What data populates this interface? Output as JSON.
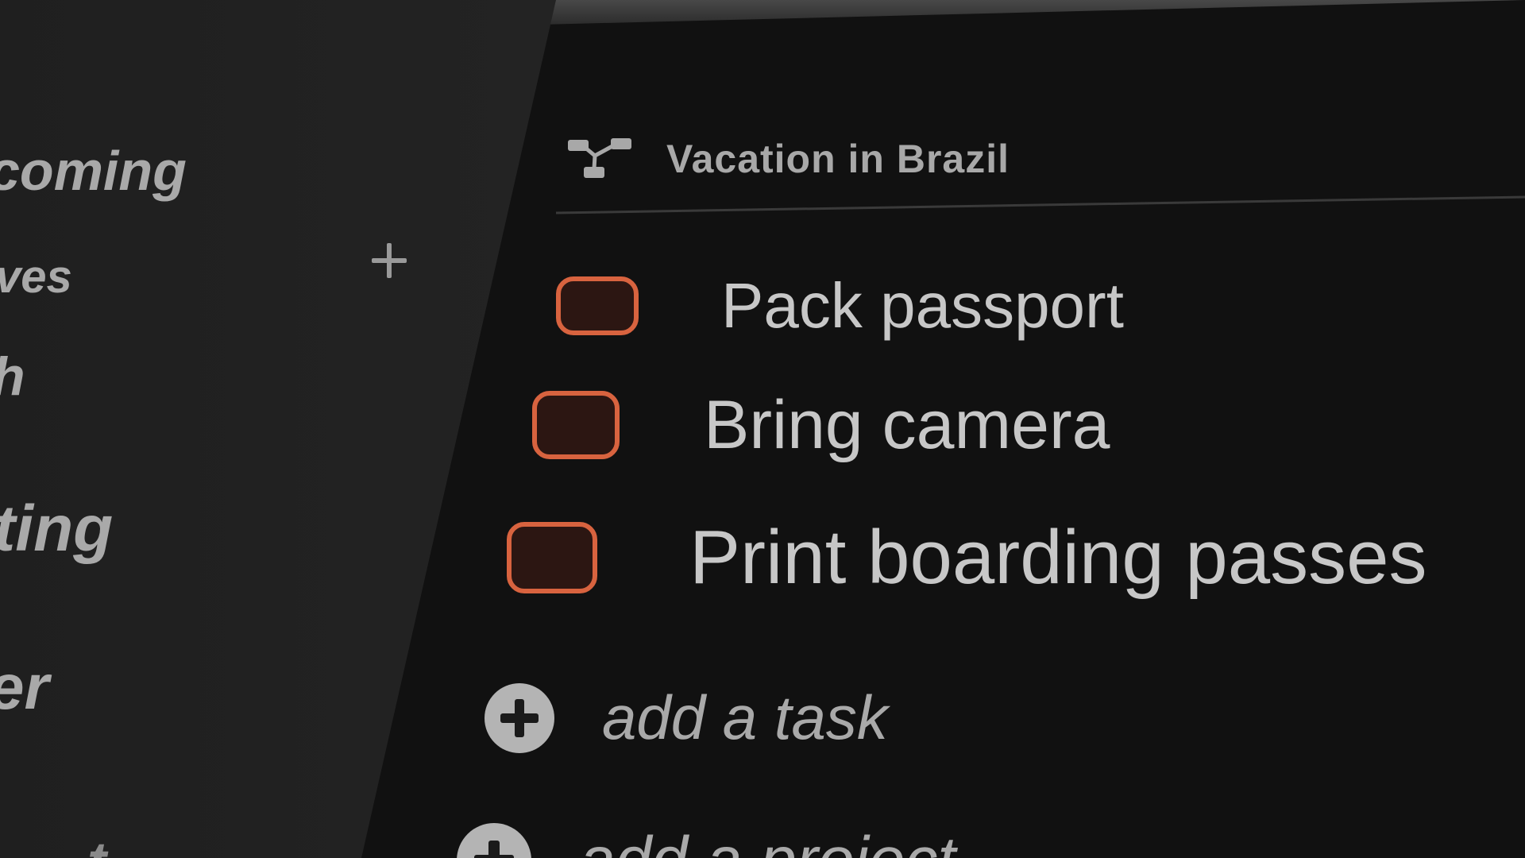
{
  "sidebar": {
    "items": [
      {
        "label": "coming"
      },
      {
        "label": "ves"
      },
      {
        "label": "h"
      },
      {
        "label": "ting"
      },
      {
        "label": "er"
      }
    ],
    "add_icon": "plus-icon",
    "partial_bottom_label": "t"
  },
  "project": {
    "title": "Vacation in Brazil",
    "icon": "project-tree-icon"
  },
  "tasks": [
    {
      "label": "Pack passport",
      "checked": false
    },
    {
      "label": "Bring camera",
      "checked": false
    },
    {
      "label": "Print boarding passes",
      "checked": false
    }
  ],
  "actions": {
    "add_task_label": "add a task",
    "add_task_icon": "plus-circle-icon",
    "add_project_label": "add a project",
    "add_project_icon": "plus-circle-icon"
  },
  "colors": {
    "background": "#111111",
    "sidebar": "#262626",
    "checkbox_accent": "#d8633f",
    "text": "#c7c7c7"
  }
}
